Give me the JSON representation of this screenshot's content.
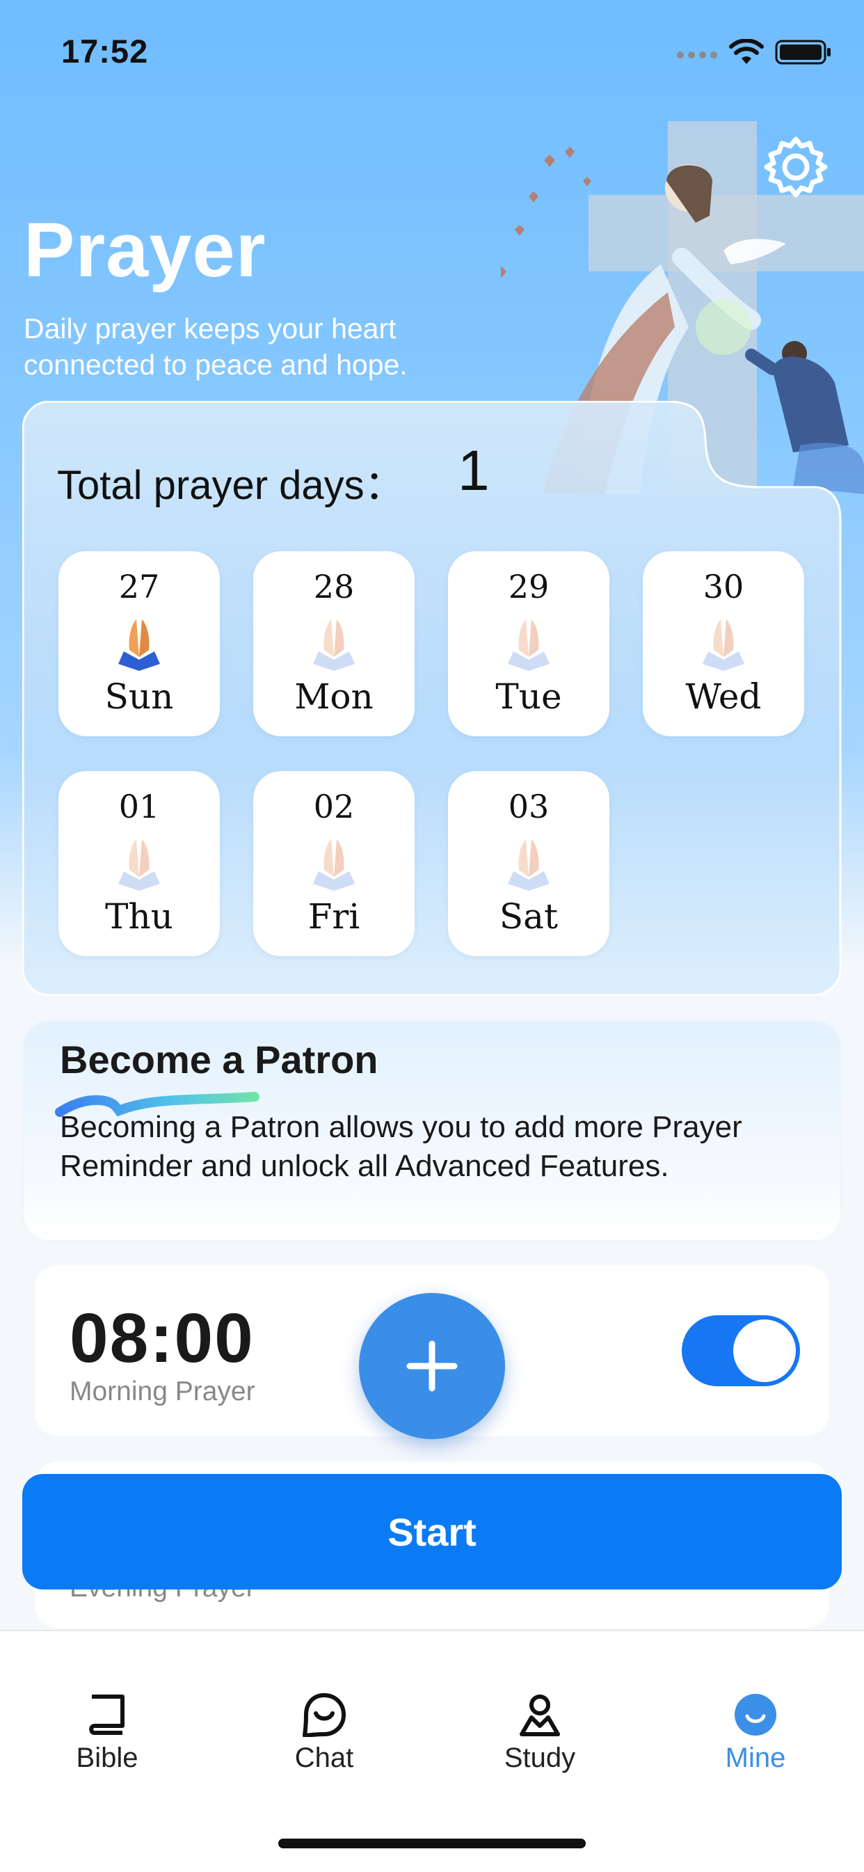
{
  "status_bar": {
    "time": "17:52"
  },
  "header": {
    "title": "Prayer",
    "subtitle": "Daily prayer keeps your heart connected to peace and hope."
  },
  "stats": {
    "total_label": "Total prayer days：",
    "total_value": "1",
    "days": [
      {
        "date": "27",
        "day": "Sun",
        "prayed": true
      },
      {
        "date": "28",
        "day": "Mon",
        "prayed": false
      },
      {
        "date": "29",
        "day": "Tue",
        "prayed": false
      },
      {
        "date": "30",
        "day": "Wed",
        "prayed": false
      },
      {
        "date": "01",
        "day": "Thu",
        "prayed": false
      },
      {
        "date": "02",
        "day": "Fri",
        "prayed": false
      },
      {
        "date": "03",
        "day": "Sat",
        "prayed": false
      }
    ]
  },
  "patron": {
    "title": "Become a Patron",
    "body": "Becoming a Patron allows you to add more Prayer Reminder and unlock all Advanced Features."
  },
  "reminders": [
    {
      "time": "08:00",
      "label": "Morning Prayer",
      "enabled": true
    },
    {
      "time": "",
      "label": "Evening Prayer",
      "enabled": true
    }
  ],
  "start_button": {
    "label": "Start"
  },
  "tab_bar": {
    "items": [
      {
        "label": "Bible",
        "icon": "book-icon",
        "active": false
      },
      {
        "label": "Chat",
        "icon": "chat-smile-icon",
        "active": false
      },
      {
        "label": "Study",
        "icon": "person-icon",
        "active": false
      },
      {
        "label": "Mine",
        "icon": "mine-icon",
        "active": true
      }
    ]
  },
  "colors": {
    "accent": "#0b7bf5",
    "fab": "#3a8ee8",
    "active_tab": "#3b8fe6",
    "header_sky": "#6fbcff"
  }
}
